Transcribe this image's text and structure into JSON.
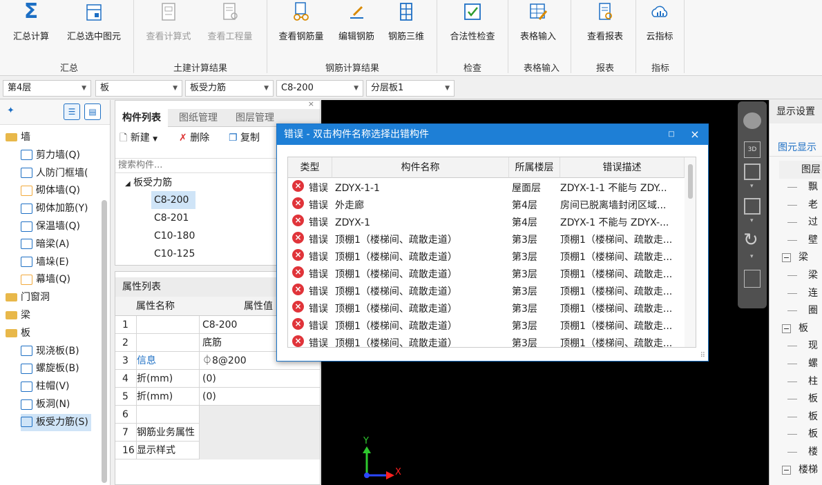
{
  "ribbon": {
    "buttons": [
      {
        "label": "汇总计算",
        "icon": "sigma-icon"
      },
      {
        "label": "汇总选中图元",
        "icon": "sum-selected-icon"
      },
      {
        "label": "查看计算式",
        "icon": "view-formula-icon"
      },
      {
        "label": "查看工程量",
        "icon": "view-quantity-icon"
      },
      {
        "label": "查看钢筋量",
        "icon": "view-rebar-icon"
      },
      {
        "label": "编辑钢筋",
        "icon": "edit-rebar-icon"
      },
      {
        "label": "钢筋三维",
        "icon": "rebar-3d-icon"
      },
      {
        "label": "合法性检查",
        "icon": "check-icon"
      },
      {
        "label": "表格输入",
        "icon": "table-input-icon"
      },
      {
        "label": "查看报表",
        "icon": "report-icon"
      },
      {
        "label": "云指标",
        "icon": "cloud-index-icon"
      }
    ],
    "groups": [
      "汇总",
      "土建计算结果",
      "钢筋计算结果",
      "检查",
      "表格输入",
      "报表",
      "指标"
    ]
  },
  "selectors": [
    "第4层",
    "板",
    "板受力筋",
    "C8-200",
    "分层板1"
  ],
  "left_tree": {
    "items": [
      {
        "label": "墙",
        "icon": "folder-icon"
      },
      {
        "label": "剪力墙(Q)",
        "icon": "shear-wall-icon"
      },
      {
        "label": "人防门框墙(",
        "icon": "door-frame-wall-icon"
      },
      {
        "label": "砌体墙(Q)",
        "icon": "masonry-wall-icon"
      },
      {
        "label": "砌体加筋(Y)",
        "icon": "masonry-rebar-icon"
      },
      {
        "label": "保温墙(Q)",
        "icon": "insulation-wall-icon"
      },
      {
        "label": "暗梁(A)",
        "icon": "hidden-beam-icon"
      },
      {
        "label": "墙垛(E)",
        "icon": "wall-pier-icon"
      },
      {
        "label": "幕墙(Q)",
        "icon": "curtain-wall-icon"
      },
      {
        "label": "门窗洞",
        "icon": "folder-icon"
      },
      {
        "label": "梁",
        "icon": "folder-icon"
      },
      {
        "label": "板",
        "icon": "folder-icon"
      },
      {
        "label": "现浇板(B)",
        "icon": "cast-slab-icon"
      },
      {
        "label": "螺旋板(B)",
        "icon": "spiral-slab-icon"
      },
      {
        "label": "柱帽(V)",
        "icon": "column-cap-icon"
      },
      {
        "label": "板洞(N)",
        "icon": "slab-hole-icon"
      },
      {
        "label": "板受力筋(S)",
        "icon": "slab-rebar-icon"
      }
    ]
  },
  "comp_panel": {
    "tabs": [
      "构件列表",
      "图纸管理",
      "图层管理"
    ],
    "new_label": "新建",
    "delete_label": "删除",
    "copy_label": "复制",
    "search_placeholder": "搜索构件...",
    "root": "板受力筋",
    "items": [
      "C8-200",
      "C8-201",
      "C10-180",
      "C10-125"
    ]
  },
  "prop_panel": {
    "title": "属性列表",
    "col_name": "属性名称",
    "col_value": "属性值",
    "rows": [
      {
        "idx": "1",
        "name": "",
        "value": "C8-200"
      },
      {
        "idx": "2",
        "name": "",
        "value": "底筋"
      },
      {
        "idx": "3",
        "name": "信息",
        "value": "⏀8@200"
      },
      {
        "idx": "4",
        "name": "折(mm)",
        "value": "(0)"
      },
      {
        "idx": "5",
        "name": "折(mm)",
        "value": "(0)"
      },
      {
        "idx": "6",
        "name": "",
        "value": ""
      },
      {
        "idx": "7",
        "name": "钢筋业务属性",
        "value": ""
      },
      {
        "idx": "16",
        "name": "显示样式",
        "value": ""
      }
    ]
  },
  "dialog": {
    "title": "错误 - 双击构件名称选择出错构件",
    "columns": [
      "类型",
      "构件名称",
      "所属楼层",
      "错误描述"
    ],
    "rows": [
      {
        "type": "错误",
        "name": "ZDYX-1-1",
        "floor": "屋面层",
        "desc": "ZDYX-1-1 不能与 ZDY..."
      },
      {
        "type": "错误",
        "name": "外走廊",
        "floor": "第4层",
        "desc": "房间已脱离墙封闭区域..."
      },
      {
        "type": "错误",
        "name": "ZDYX-1",
        "floor": "第4层",
        "desc": "ZDYX-1 不能与 ZDYX-..."
      },
      {
        "type": "错误",
        "name": "顶棚1（楼梯间、疏散走道）",
        "floor": "第3层",
        "desc": "顶棚1（楼梯间、疏散走..."
      },
      {
        "type": "错误",
        "name": "顶棚1（楼梯间、疏散走道）",
        "floor": "第3层",
        "desc": "顶棚1（楼梯间、疏散走..."
      },
      {
        "type": "错误",
        "name": "顶棚1（楼梯间、疏散走道）",
        "floor": "第3层",
        "desc": "顶棚1（楼梯间、疏散走..."
      },
      {
        "type": "错误",
        "name": "顶棚1（楼梯间、疏散走道）",
        "floor": "第3层",
        "desc": "顶棚1（楼梯间、疏散走..."
      },
      {
        "type": "错误",
        "name": "顶棚1（楼梯间、疏散走道）",
        "floor": "第3层",
        "desc": "顶棚1（楼梯间、疏散走..."
      },
      {
        "type": "错误",
        "name": "顶棚1（楼梯间、疏散走道）",
        "floor": "第3层",
        "desc": "顶棚1（楼梯间、疏散走..."
      },
      {
        "type": "错误",
        "name": "顶棚1（楼梯间、疏散走道）",
        "floor": "第3层",
        "desc": "顶棚1（楼梯间、疏散走..."
      }
    ]
  },
  "canvas": {
    "axis_y": "Y",
    "axis_x": "X"
  },
  "right_panel": {
    "title": "显示设置",
    "tab": "图元显示",
    "header": "图层",
    "items": [
      "飘",
      "老",
      "过",
      "壁",
      "梁",
      "梁",
      "连",
      "圈",
      "板",
      "现",
      "螺",
      "柱",
      "板",
      "板",
      "板",
      "楼",
      "楼梯"
    ]
  }
}
